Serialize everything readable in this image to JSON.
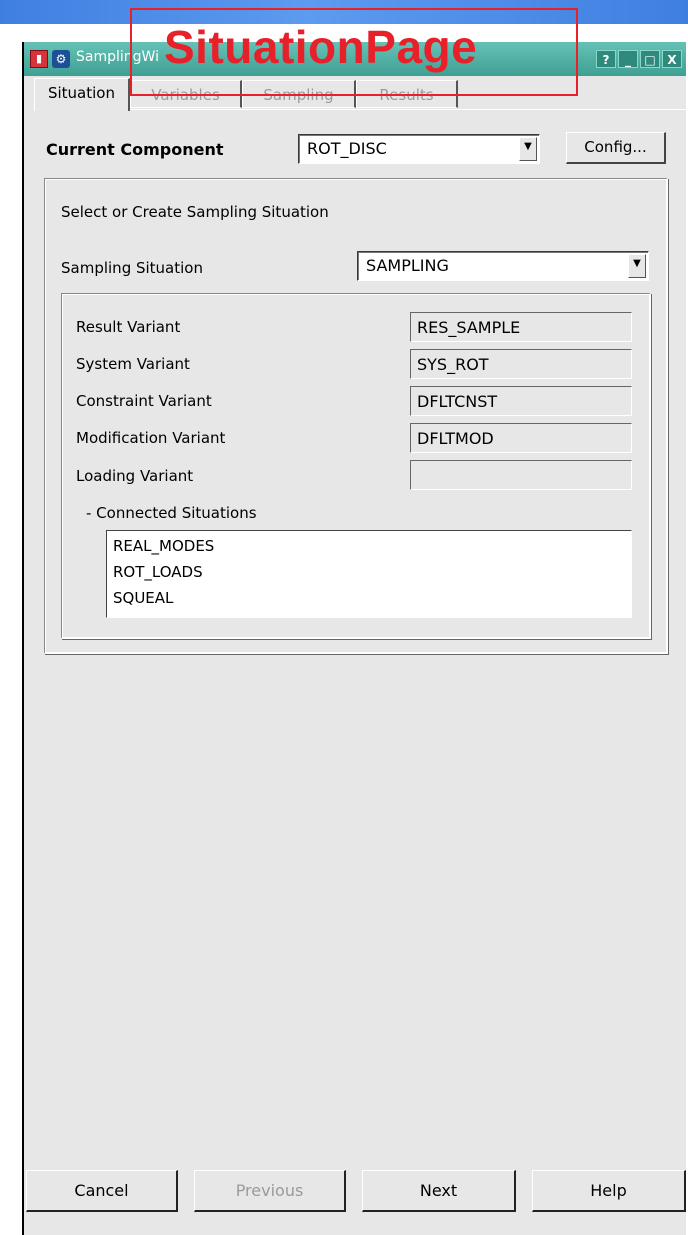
{
  "window": {
    "title": "SamplingWizard",
    "title_visible": "SamplingWi",
    "title_buttons": [
      "?",
      "_",
      "□",
      "X"
    ]
  },
  "annotation": {
    "label": "SituationPage",
    "color": "#e8202a"
  },
  "tabs": [
    {
      "label": "Situation",
      "active": true
    },
    {
      "label": "Variables",
      "active": false
    },
    {
      "label": "Sampling",
      "active": false
    },
    {
      "label": "Results",
      "active": false
    }
  ],
  "current_component": {
    "label": "Current Component",
    "value": "ROT_DISC",
    "config_label": "Config..."
  },
  "situation_group": {
    "heading": "Select or Create Sampling Situation",
    "sampling_situation_label": "Sampling Situation",
    "sampling_situation_value": "SAMPLING",
    "variants": [
      {
        "label": "Result Variant",
        "value": "RES_SAMPLE"
      },
      {
        "label": "System Variant",
        "value": "SYS_ROT"
      },
      {
        "label": "Constraint Variant",
        "value": "DFLTCNST"
      },
      {
        "label": "Modification Variant",
        "value": "DFLTMOD"
      },
      {
        "label": "Loading Variant",
        "value": ""
      }
    ],
    "connected_label": "-  Connected Situations",
    "connected": [
      "REAL_MODES",
      "ROT_LOADS",
      "SQUEAL"
    ]
  },
  "footer": {
    "cancel": "Cancel",
    "previous": "Previous",
    "next": "Next",
    "help": "Help"
  },
  "colors": {
    "titlebar": "#3ea092",
    "topbar": "#3f7fe0",
    "panel": "#e7e7e7",
    "disabled_text": "#9a9a9a"
  }
}
